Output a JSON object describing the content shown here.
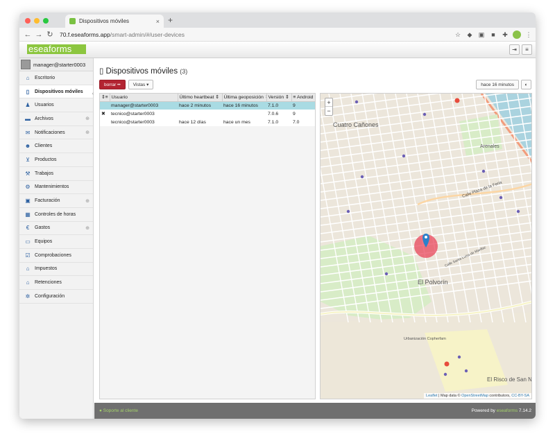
{
  "browser": {
    "tab_title": "Dispositivos móviles",
    "tab_close": "×",
    "new_tab": "+",
    "url_host": "70.f.eseaforms.app",
    "url_path": "/smart-admin/#/user-devices"
  },
  "app": {
    "logo": "eseaforms",
    "user": "manager@starter0003",
    "nav": [
      {
        "label": "Escritorio",
        "icon": "home-icon",
        "plus": false
      },
      {
        "label": "Dispositivos móviles",
        "icon": "mobile-icon",
        "plus": false,
        "active": true
      },
      {
        "label": "Usuarios",
        "icon": "user-icon",
        "plus": false
      },
      {
        "label": "Archivos",
        "icon": "folder-icon",
        "plus": true
      },
      {
        "label": "Notificaciones",
        "icon": "envelope-icon",
        "plus": true
      },
      {
        "label": "Clientes",
        "icon": "users-icon",
        "plus": false
      },
      {
        "label": "Productos",
        "icon": "cart-icon",
        "plus": false
      },
      {
        "label": "Trabajos",
        "icon": "tools-icon",
        "plus": false
      },
      {
        "label": "Mantenimientos",
        "icon": "wrench-icon",
        "plus": false
      },
      {
        "label": "Facturación",
        "icon": "money-icon",
        "plus": true
      },
      {
        "label": "Controles de horas",
        "icon": "calendar-icon",
        "plus": false
      },
      {
        "label": "Gastos",
        "icon": "euro-icon",
        "plus": true
      },
      {
        "label": "Equipos",
        "icon": "laptop-icon",
        "plus": false
      },
      {
        "label": "Comprobaciones",
        "icon": "check-icon",
        "plus": false
      },
      {
        "label": "Impuestos",
        "icon": "bank-icon",
        "plus": false
      },
      {
        "label": "Retenciones",
        "icon": "bank-icon",
        "plus": false
      },
      {
        "label": "Configuración",
        "icon": "gear-icon",
        "plus": false
      }
    ]
  },
  "page": {
    "title": "Dispositivos móviles",
    "count": "(3)",
    "delete_btn": "borrar ••",
    "views_btn": "Vistas ▾",
    "time_btn": "hace 16 minutos"
  },
  "table": {
    "headers": [
      "Usuario",
      "Último heartbeat",
      "Última geoposición",
      "Versión",
      "Android"
    ],
    "rows": [
      {
        "user": "manager@starter0003",
        "heartbeat": "hace 2 minutos",
        "geo": "hace 16 minutos",
        "version": "7.1.0",
        "android": "9",
        "selected": true,
        "mark": ""
      },
      {
        "user": "tecnico@starter0003",
        "heartbeat": "",
        "geo": "",
        "version": "7.0.6",
        "android": "9",
        "selected": false,
        "mark": "✖"
      },
      {
        "user": "tecnico@starter0003",
        "heartbeat": "hace 12 días",
        "geo": "hace un mes",
        "version": "7.1.0",
        "android": "7.0",
        "selected": false,
        "mark": ""
      }
    ]
  },
  "map": {
    "zoom_in": "+",
    "zoom_out": "−",
    "attr_leaflet": "Leaflet",
    "attr_text": " | Map data © ",
    "attr_osm": "OpenStreetMap",
    "attr_rest": " contributors, ",
    "attr_cc": "CC-BY-SA",
    "labels": [
      {
        "text": "Cuatro Cañones"
      },
      {
        "text": "Arenales"
      },
      {
        "text": "Calle Plaza de la Feria"
      },
      {
        "text": "El Polvorín"
      },
      {
        "text": "Urbanización Copherfam"
      },
      {
        "text": "El Risco de San Nicolás"
      },
      {
        "text": "Calle Santa Luisa de Marillac"
      }
    ],
    "marker_color": "#2a81cb",
    "circle_color": "#e83b52"
  },
  "footer": {
    "support": "Soporte al cliente",
    "powered_prefix": "Powered by ",
    "brand": "eseaforms",
    "version": " 7.14.2"
  },
  "colors": {
    "accent": "#8cc63f",
    "danger": "#b32432",
    "selected_row": "#a9dbe3"
  }
}
